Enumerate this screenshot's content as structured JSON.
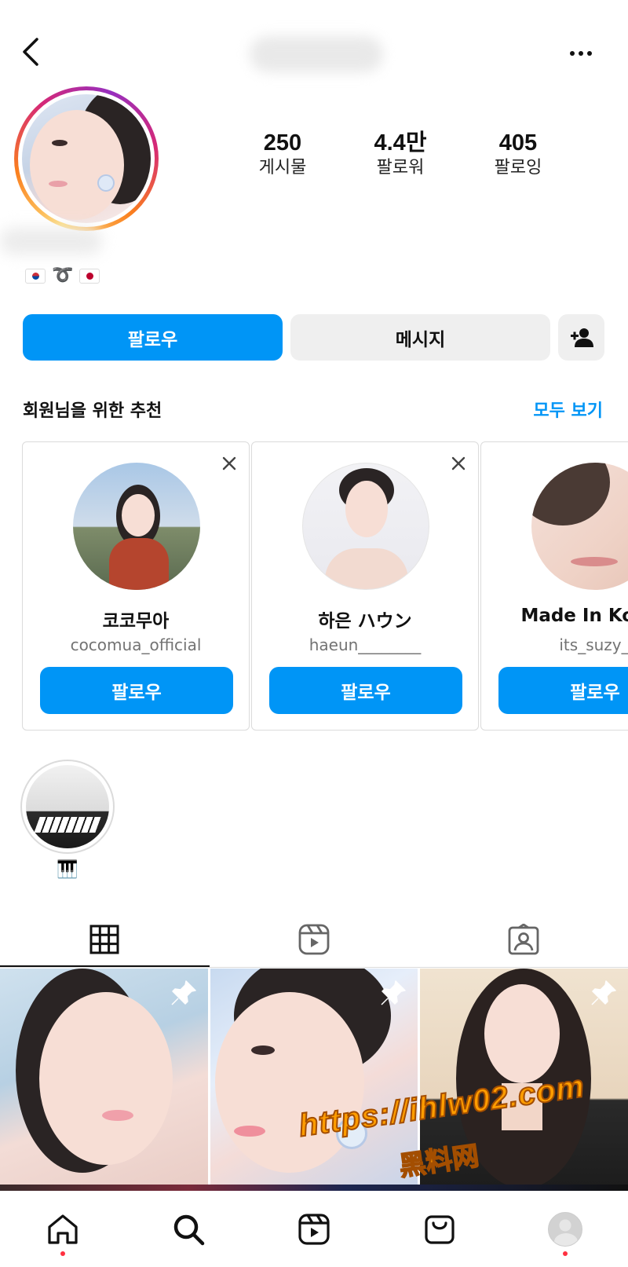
{
  "header": {
    "back_icon": "chevron-left-icon",
    "more_icon": "more-horizontal-icon"
  },
  "profile": {
    "stats": [
      {
        "value": "250",
        "label": "게시물"
      },
      {
        "value": "4.4만",
        "label": "팔로워"
      },
      {
        "value": "405",
        "label": "팔로잉"
      }
    ],
    "bio_icons": [
      "south-korea-flag-icon",
      "ribbon-icon",
      "japan-flag-icon"
    ],
    "bio_ribbon": "➰"
  },
  "actions": {
    "follow_label": "팔로우",
    "message_label": "메시지",
    "add_user_icon": "add-user-icon"
  },
  "suggestions": {
    "title": "회원님을 위한 추천",
    "see_all": "모두 보기",
    "cards": [
      {
        "name": "코코무아",
        "handle": "cocomua_official",
        "button": "팔로우"
      },
      {
        "name": "하은 ハウン",
        "handle": "haeun________",
        "button": "팔로우"
      },
      {
        "name": "Made In Korea",
        "handle": "its_suzy_",
        "button": "팔로우"
      }
    ]
  },
  "highlights": [
    {
      "label": "🎹"
    }
  ],
  "tabs": [
    {
      "icon": "grid-icon",
      "active": true
    },
    {
      "icon": "reels-icon",
      "active": false
    },
    {
      "icon": "tagged-user-icon",
      "active": false
    }
  ],
  "posts": [
    {
      "pinned": true
    },
    {
      "pinned": true
    },
    {
      "pinned": true
    }
  ],
  "watermark": {
    "url": "https://ihlw02.com",
    "text": "黑料网"
  },
  "bottom_nav": [
    {
      "icon": "home-icon",
      "dot": true
    },
    {
      "icon": "search-icon",
      "dot": false
    },
    {
      "icon": "reels-icon",
      "dot": false
    },
    {
      "icon": "shop-icon",
      "dot": false
    },
    {
      "icon": "profile-avatar",
      "dot": true
    }
  ],
  "colors": {
    "accent": "#0095f6",
    "secondary_button": "#efefef",
    "notification_dot": "#ff3040"
  }
}
